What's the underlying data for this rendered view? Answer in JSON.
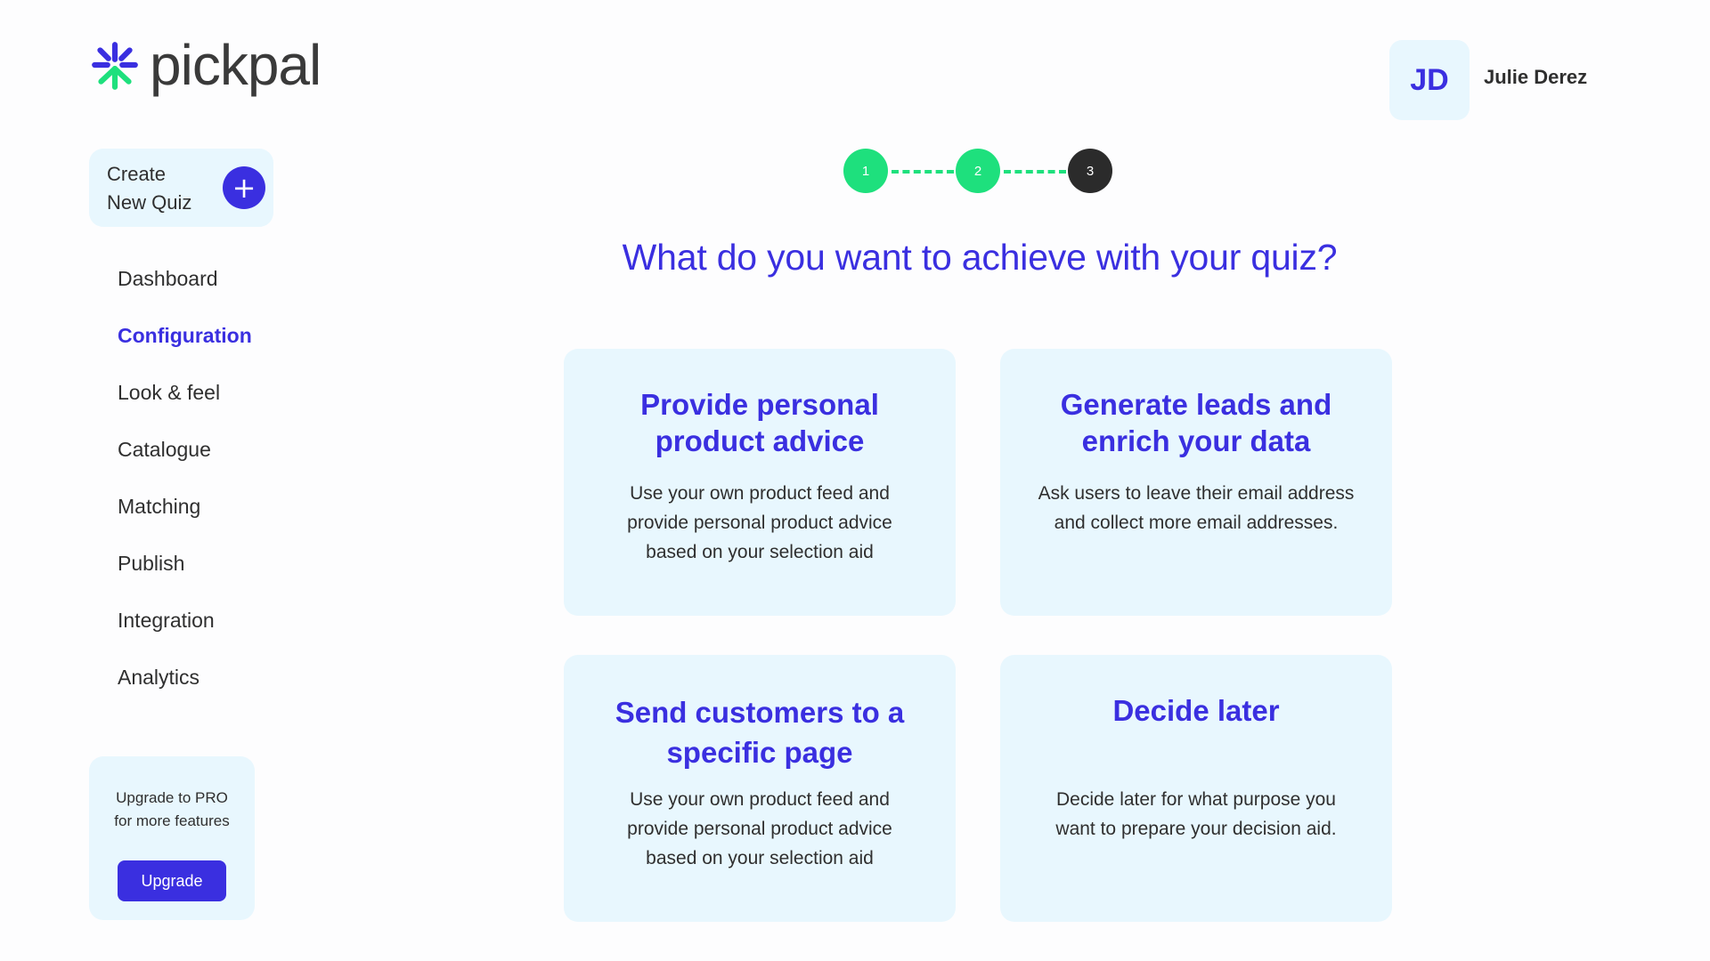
{
  "brand": {
    "name": "pickpal",
    "accent": "#3a2fe0",
    "success": "#1ee07d",
    "card_bg": "#e8f7fe"
  },
  "user": {
    "initials": "JD",
    "name": "Julie Derez"
  },
  "sidebar": {
    "create_line1": "Create",
    "create_line2": "New Quiz",
    "create_icon": "plus-icon",
    "items": [
      {
        "label": "Dashboard",
        "active": false
      },
      {
        "label": "Configuration",
        "active": true
      },
      {
        "label": "Look & feel",
        "active": false
      },
      {
        "label": "Catalogue",
        "active": false
      },
      {
        "label": "Matching",
        "active": false
      },
      {
        "label": "Publish",
        "active": false
      },
      {
        "label": "Integration",
        "active": false
      },
      {
        "label": "Analytics",
        "active": false
      }
    ],
    "upgrade": {
      "line1": "Upgrade to PRO",
      "line2": "for more features",
      "button": "Upgrade"
    }
  },
  "stepper": {
    "steps": [
      "1",
      "2",
      "3"
    ],
    "current": 3
  },
  "main": {
    "heading": "What do you want to achieve with your quiz?",
    "cards": [
      {
        "title": "Provide personal product advice",
        "description": "Use your own product feed and provide personal product advice based on your selection aid"
      },
      {
        "title": "Generate leads and enrich your data",
        "description": "Ask users to leave their email address and collect more email addresses."
      },
      {
        "title": "Send customers to a specific page",
        "description": "Use your own product feed and provide personal product advice based on your selection aid"
      },
      {
        "title": "Decide later",
        "description": "Decide later for what purpose you want to prepare your decision aid."
      }
    ]
  }
}
